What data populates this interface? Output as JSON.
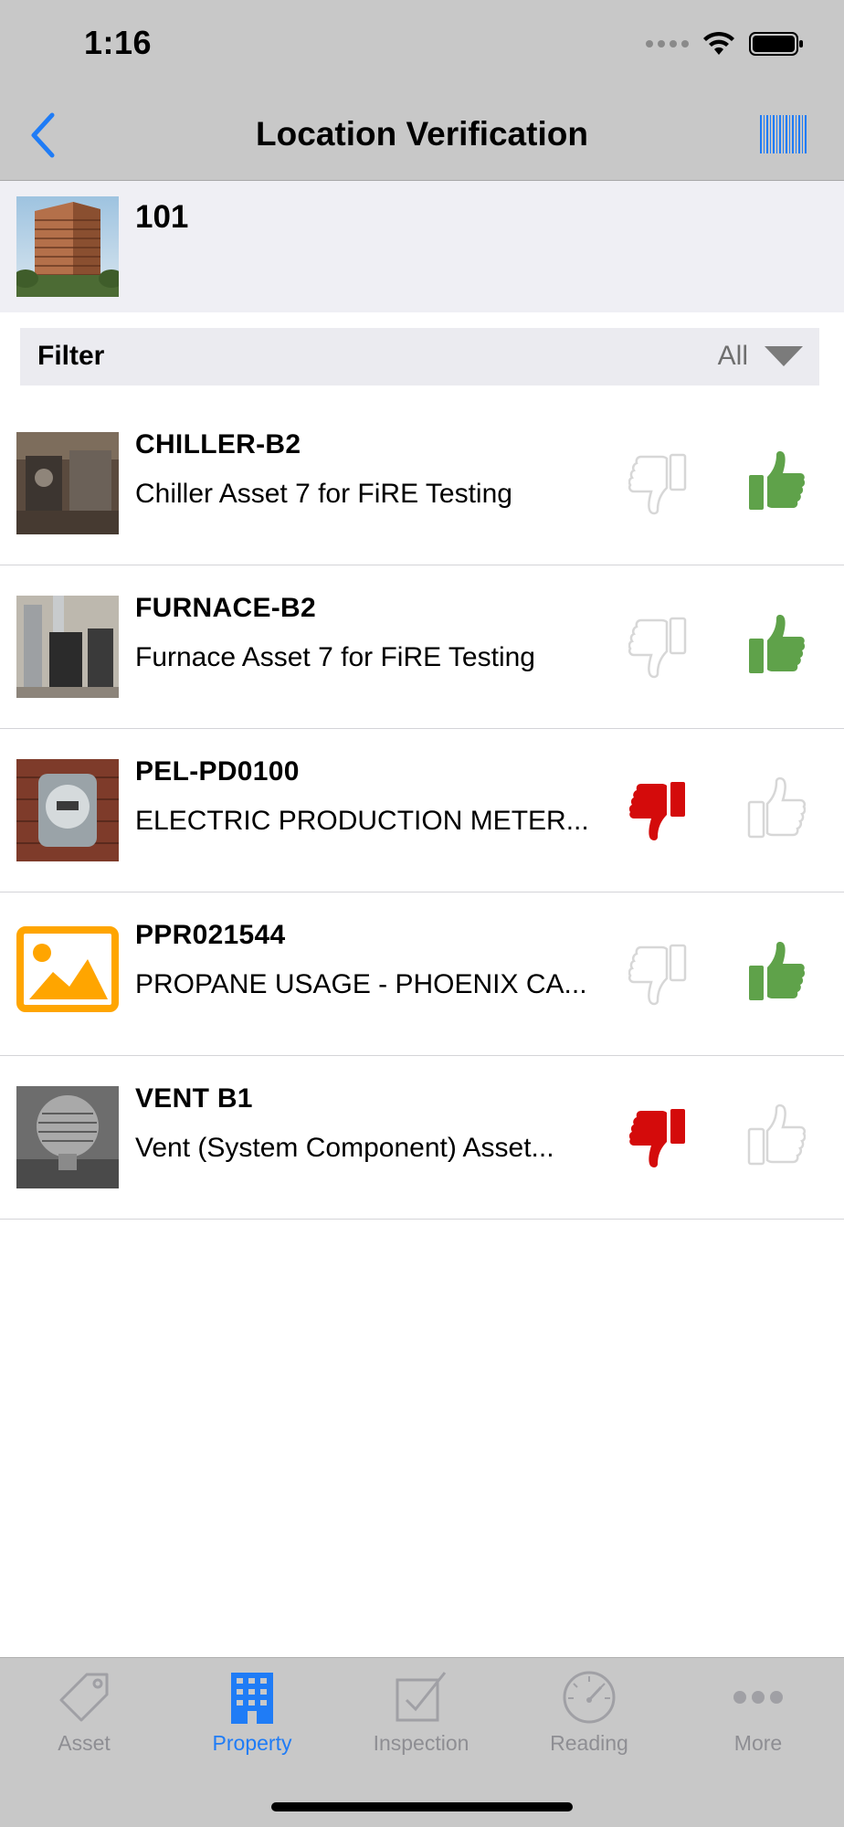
{
  "status": {
    "time": "1:16"
  },
  "nav": {
    "title": "Location Verification"
  },
  "property": {
    "name": "101"
  },
  "filter": {
    "label": "Filter",
    "value": "All"
  },
  "assets": [
    {
      "code": "CHILLER-B2",
      "description": "Chiller Asset 7 for FiRE Testing",
      "thumbs_down_selected": false,
      "thumbs_up_selected": true
    },
    {
      "code": "FURNACE-B2",
      "description": "Furnace Asset 7 for FiRE Testing",
      "thumbs_down_selected": false,
      "thumbs_up_selected": true
    },
    {
      "code": "PEL-PD0100",
      "description": "ELECTRIC PRODUCTION METER...",
      "thumbs_down_selected": true,
      "thumbs_up_selected": false
    },
    {
      "code": "PPR021544",
      "description": "PROPANE USAGE - PHOENIX CA...",
      "thumbs_down_selected": false,
      "thumbs_up_selected": true
    },
    {
      "code": "VENT B1",
      "description": "Vent (System Component) Asset...",
      "thumbs_down_selected": true,
      "thumbs_up_selected": false
    }
  ],
  "tabs": [
    {
      "label": "Asset",
      "icon": "tag-icon",
      "active": false
    },
    {
      "label": "Property",
      "icon": "building-icon",
      "active": true
    },
    {
      "label": "Inspection",
      "icon": "checkbox-icon",
      "active": false
    },
    {
      "label": "Reading",
      "icon": "gauge-icon",
      "active": false
    },
    {
      "label": "More",
      "icon": "more-icon",
      "active": false
    }
  ],
  "colors": {
    "accent": "#1f7cf6",
    "thumb_up_active": "#5fa24a",
    "thumb_down_active": "#d40b0b",
    "thumb_inactive": "#d7d7d7",
    "placeholder_orange": "#ffa500"
  }
}
